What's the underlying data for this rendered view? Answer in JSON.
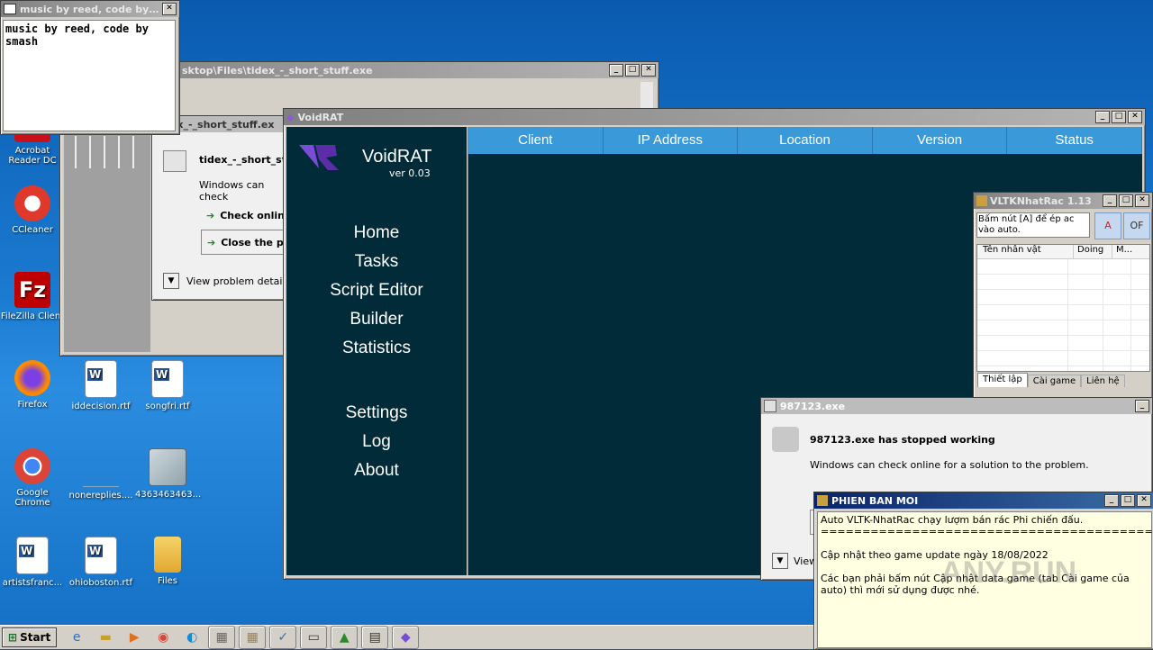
{
  "desktop": {
    "icons": [
      {
        "label": "Acrobat Reader DC"
      },
      {
        "label": "CCleaner"
      },
      {
        "label": "FileZilla Client"
      },
      {
        "label": "Firefox"
      },
      {
        "label": "iddecision.rtf"
      },
      {
        "label": "songfri.rtf"
      },
      {
        "label": "Google Chrome"
      },
      {
        "label": "nonereplies...."
      },
      {
        "label": "4363463463..."
      },
      {
        "label": "artistsfranc..."
      },
      {
        "label": "ohioboston.rtf"
      },
      {
        "label": "Files"
      }
    ]
  },
  "music_window": {
    "title": "music by reed, code by sm...",
    "text": "music by reed, code by smash"
  },
  "explorer_window": {
    "title": "sktop\\Files\\tidex_-_short_stuff.exe"
  },
  "tidex_dialog": {
    "title": "tidex_-_short_stuff.ex",
    "heading": "tidex_-_short_st",
    "message": "Windows can check",
    "check_online": "Check onlin",
    "close_program": "Close the p",
    "view_details": "View problem details"
  },
  "voidrat": {
    "title": "VoidRAT",
    "app_name": "VoidRAT",
    "version": "ver 0.03",
    "nav": [
      "Home",
      "Tasks",
      "Script Editor",
      "Builder",
      "Statistics"
    ],
    "nav2": [
      "Settings",
      "Log",
      "About"
    ],
    "columns": [
      "Client",
      "IP Address",
      "Location",
      "Version",
      "Status"
    ]
  },
  "vltk": {
    "title": "VLTKNhatRac 1.13",
    "hint": "Bấm nút [A] để ép ac vào auto.",
    "btn_a": "A",
    "btn_of": "OF",
    "columns": [
      "Tên nhân vật",
      "Doing",
      "M..."
    ],
    "tabs": [
      "Thiết lập",
      "Cài game",
      "Liên hệ"
    ]
  },
  "crash_dialog": {
    "title": "987123.exe",
    "heading": "987123.exe has stopped working",
    "message": "Windows can check online for a solution to the problem.",
    "view": "View"
  },
  "phien_ban": {
    "title": "PHIEN BAN MOI",
    "line1": "Auto VLTK-NhatRac chạy lượm bán rác Phi chiến đấu.",
    "line2": "==========================================",
    "line3": "Cập nhật theo game update ngày 18/08/2022",
    "line4": "Các bạn phải bấm nút Cập nhật data game (tab Cài game của auto) thì mới sử dụng được nhé."
  },
  "taskbar": {
    "start": "Start"
  },
  "watermark": "ANY.RUN",
  "colors": {
    "voidrat_bg": "#022b3a",
    "voidrat_header": "#3a9ad9",
    "note_bg": "#ffffe1"
  }
}
